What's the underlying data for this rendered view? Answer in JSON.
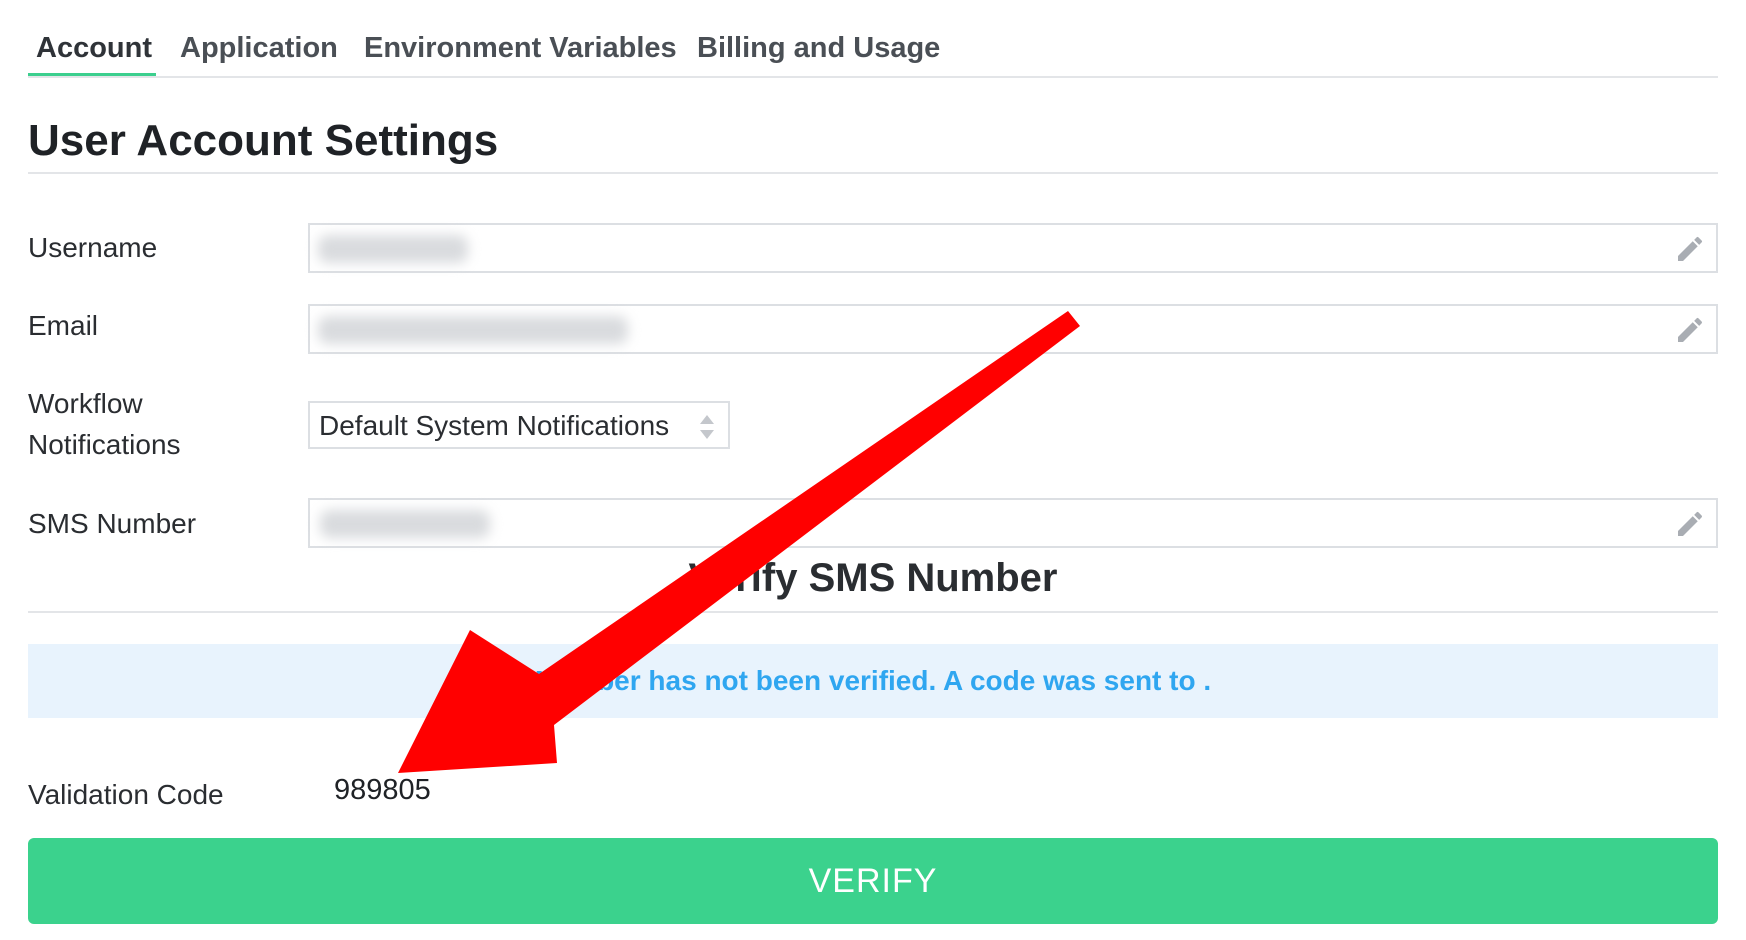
{
  "tabs": [
    {
      "label": "Account",
      "active": true
    },
    {
      "label": "Application",
      "active": false
    },
    {
      "label": "Environment Variables",
      "active": false
    },
    {
      "label": "Billing and Usage",
      "active": false
    }
  ],
  "page": {
    "title": "User Account Settings"
  },
  "form": {
    "username_label": "Username",
    "email_label": "Email",
    "workflow_label_line1": "Workflow",
    "workflow_label_line2": "Notifications",
    "workflow_value": "Default System Notifications",
    "sms_label": "SMS Number"
  },
  "verify": {
    "heading": "Verify SMS Number",
    "notice": "Number has not been verified. A code was sent to .",
    "code_label": "Validation Code",
    "code_value": "989805",
    "button_label": "VERIFY"
  },
  "colors": {
    "accent": "#3ccf8e",
    "notice_text": "#2fa6f0",
    "notice_bg": "#e8f3fd",
    "annotation_arrow": "#ff0000"
  },
  "icons": {
    "field_edit": "pencil-icon",
    "select": "updown-arrows-icon"
  }
}
